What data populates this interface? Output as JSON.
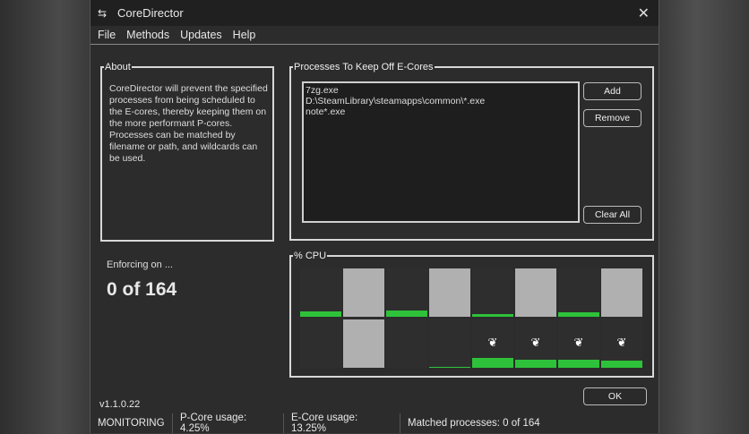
{
  "title": "CoreDirector",
  "menu": [
    "File",
    "Methods",
    "Updates",
    "Help"
  ],
  "about": {
    "legend": "About",
    "text": "CoreDirector will prevent the specified processes from being scheduled to the E-cores, thereby keeping them on the more performant P-cores. Processes can be matched by filename or path, and wildcards can be used."
  },
  "processes": {
    "legend": "Processes To Keep Off E-Cores",
    "items": [
      "7zg.exe",
      "D:\\SteamLibrary\\steamapps\\common\\*.exe",
      "note*.exe"
    ],
    "add": "Add",
    "remove": "Remove",
    "clear": "Clear All"
  },
  "enforcing": {
    "label": "Enforcing on ...",
    "value": "0 of 164"
  },
  "cpu": {
    "legend": "% CPU",
    "accent": "#2ec23a",
    "cells": [
      {
        "row": 0,
        "col": 0,
        "disabled": false,
        "usage": 11,
        "ecore": false
      },
      {
        "row": 0,
        "col": 1,
        "disabled": true,
        "usage": 0,
        "ecore": false
      },
      {
        "row": 0,
        "col": 2,
        "disabled": false,
        "usage": 13,
        "ecore": false
      },
      {
        "row": 0,
        "col": 3,
        "disabled": true,
        "usage": 0,
        "ecore": false
      },
      {
        "row": 0,
        "col": 4,
        "disabled": false,
        "usage": 6,
        "ecore": false
      },
      {
        "row": 0,
        "col": 5,
        "disabled": true,
        "usage": 0,
        "ecore": false
      },
      {
        "row": 0,
        "col": 6,
        "disabled": false,
        "usage": 10,
        "ecore": false
      },
      {
        "row": 0,
        "col": 7,
        "disabled": true,
        "usage": 0,
        "ecore": false
      },
      {
        "row": 1,
        "col": 0,
        "disabled": false,
        "usage": 0,
        "ecore": false
      },
      {
        "row": 1,
        "col": 1,
        "disabled": true,
        "usage": 0,
        "ecore": false
      },
      {
        "row": 1,
        "col": 2,
        "disabled": false,
        "usage": 0,
        "ecore": false
      },
      {
        "row": 1,
        "col": 3,
        "disabled": false,
        "usage": 2,
        "ecore": false
      },
      {
        "row": 1,
        "col": 4,
        "disabled": false,
        "usage": 21,
        "ecore": true
      },
      {
        "row": 1,
        "col": 5,
        "disabled": false,
        "usage": 17,
        "ecore": true
      },
      {
        "row": 1,
        "col": 6,
        "disabled": false,
        "usage": 17,
        "ecore": true
      },
      {
        "row": 1,
        "col": 7,
        "disabled": false,
        "usage": 14,
        "ecore": true
      }
    ]
  },
  "version": "v1.1.0.22",
  "ok": "OK",
  "status": {
    "mode": "MONITORING",
    "pcore": "P-Core usage: 4.25%",
    "ecore": "E-Core usage: 13.25%",
    "matched": "Matched processes: 0 of 164"
  }
}
